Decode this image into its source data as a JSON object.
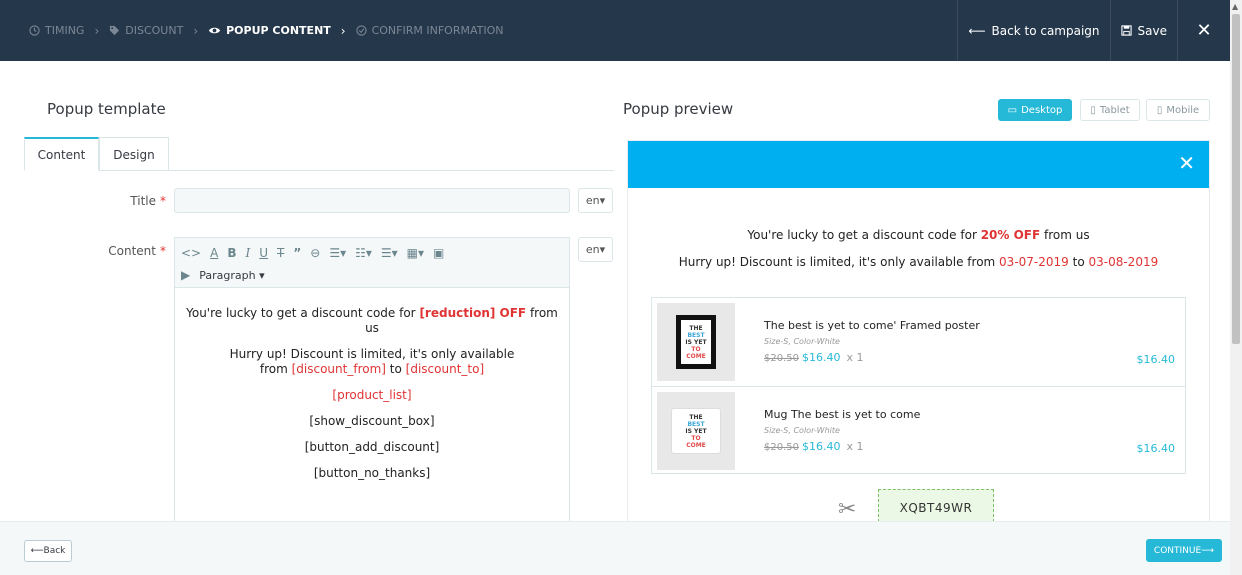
{
  "wizard": {
    "steps": [
      {
        "label": "TIMING",
        "icon": "clock-icon"
      },
      {
        "label": "DISCOUNT",
        "icon": "tag-icon"
      },
      {
        "label": "POPUP CONTENT",
        "icon": "eye-icon"
      },
      {
        "label": "CONFIRM INFORMATION",
        "icon": "check-circle-icon"
      }
    ],
    "separator": "›",
    "back_label": "Back to campaign",
    "save_label": "Save",
    "close_glyph": "✕"
  },
  "template": {
    "heading": "Popup template",
    "tabs": [
      "Content",
      "Design"
    ],
    "title_label": "Title",
    "content_label": "Content",
    "required_mark": "*",
    "title_value": "",
    "lang": "en",
    "block_format": "Paragraph",
    "body": {
      "line1_pre": "You're lucky to get a discount code for ",
      "line1_token": "[reduction] OFF",
      "line1_post": " from us",
      "line2_pre": "Hurry up! Discount is limited, it's only available",
      "line2_from_word": "from ",
      "line2_from_token": "[discount_from]",
      "line2_to_word": " to ",
      "line2_to_token": "[discount_to]",
      "product_list": "[product_list]",
      "discount_box": "[show_discount_box]",
      "add_discount": "[button_add_discount]",
      "no_thanks": "[button_no_thanks]"
    }
  },
  "preview": {
    "heading": "Popup preview",
    "devices": [
      "Desktop",
      "Tablet",
      "Mobile"
    ],
    "active_device": "Desktop",
    "close_glyph": "✕",
    "line1_pre": "You're lucky to get a discount code for ",
    "line1_bold": "20% OFF",
    "line1_post": " from us",
    "line2_pre": "Hurry up! Discount is limited, it's only available from ",
    "date_from": "03-07-2019",
    "line2_mid": " to ",
    "date_to": "03-08-2019",
    "products": [
      {
        "name": "The best is yet to come' Framed poster",
        "attrs": "Size-S, Color-White",
        "old_price": "$20.50",
        "new_price": "$16.40",
        "qty": "x 1",
        "total": "$16.40"
      },
      {
        "name": "Mug The best is yet to come",
        "attrs": "Size-S, Color-White",
        "old_price": "$20.50",
        "new_price": "$16.40",
        "qty": "x 1",
        "total": "$16.40"
      }
    ],
    "thumb_text": [
      "THE",
      "BEST",
      "IS YET",
      "TO",
      "COME"
    ],
    "discount_code": "XQBT49WR"
  },
  "footer": {
    "back_label": "Back",
    "continue_label": "CONTINUE"
  },
  "colors": {
    "topbar": "#25374b",
    "accent": "#25b9d7",
    "popup_header": "#00aff0",
    "required": "#e03434"
  }
}
